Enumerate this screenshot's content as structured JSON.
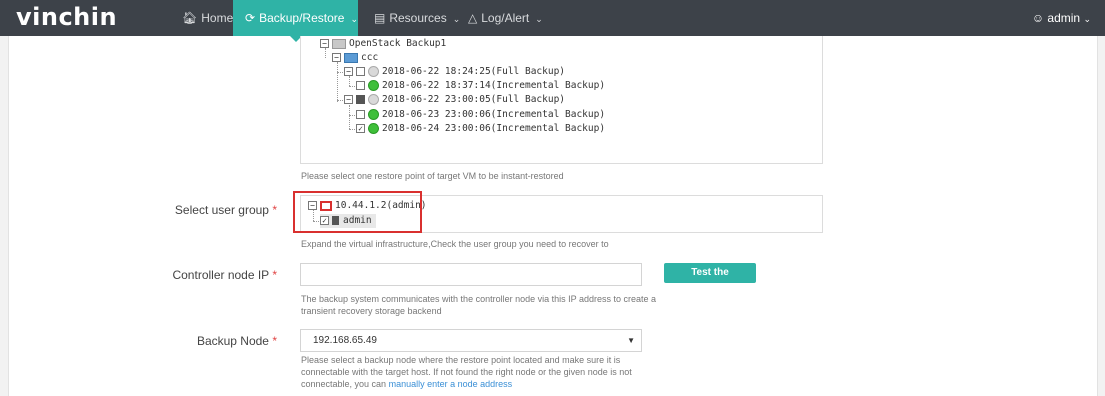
{
  "app": {
    "logo": "vinchin"
  },
  "nav": {
    "home": "Home",
    "backup_restore": "Backup/Restore",
    "resources": "Resources",
    "log_alert": "Log/Alert",
    "user": "admin"
  },
  "restore_tree": {
    "root": "OpenStack Backup1",
    "vm": "ccc",
    "points": [
      "2018-06-22 18:24:25(Full Backup)",
      "2018-06-22 18:37:14(Incremental Backup)",
      "2018-06-22 23:00:05(Full Backup)",
      "2018-06-23 23:00:06(Incremental Backup)",
      "2018-06-24 23:00:06(Incremental Backup)"
    ],
    "hint": "Please select one restore point of target VM to be instant-restored"
  },
  "user_group": {
    "label": "Select user group",
    "required": "*",
    "host": "10.44.1.2(admin)",
    "group": "admin",
    "hint": "Expand the virtual infrastructure,Check the user group you need to recover to"
  },
  "controller": {
    "label": "Controller node IP",
    "required": "*",
    "value": "",
    "button": "Test the connection",
    "hint1": "The backup system communicates with the controller node via this IP address to create a",
    "hint2": "transient recovery storage backend"
  },
  "backup_node": {
    "label": "Backup Node",
    "required": "*",
    "selected": "192.168.65.49",
    "hint1": "Please select a backup node where the restore point located and make sure it is",
    "hint2": "connectable with the target host. If not found the right node or the given node is not",
    "hint3_prefix": "connectable, you can",
    "hint3_link": "manually enter a node address"
  },
  "colors": {
    "topbar": "#3d4249",
    "accent": "#2fb3a6",
    "highlight": "#d9302f",
    "link": "#3a8fd6"
  }
}
